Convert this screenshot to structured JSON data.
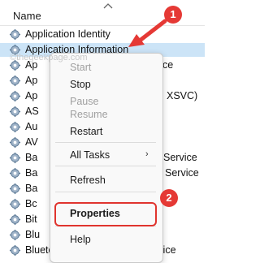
{
  "header": {
    "column_name": "Name"
  },
  "services": [
    {
      "name": "Application Identity",
      "tail": "",
      "selected": false
    },
    {
      "name": "Application Information",
      "tail": "",
      "selected": true
    },
    {
      "name": "Ap",
      "tail": "ce",
      "selected": false
    },
    {
      "name": "Ap",
      "tail": "",
      "selected": false
    },
    {
      "name": "Ap",
      "tail": "XSVC)",
      "selected": false
    },
    {
      "name": "AS",
      "tail": "",
      "selected": false
    },
    {
      "name": "Au",
      "tail": "",
      "selected": false
    },
    {
      "name": "AV",
      "tail": "",
      "selected": false
    },
    {
      "name": "Ba",
      "tail": "Service",
      "selected": false
    },
    {
      "name": "Ba",
      "tail": "Service",
      "selected": false
    },
    {
      "name": "Ba",
      "tail": "",
      "selected": false
    },
    {
      "name": "Bc",
      "tail": "",
      "selected": false
    },
    {
      "name": "Bit",
      "tail": "",
      "selected": false
    },
    {
      "name": "Blu",
      "tail": "",
      "selected": false
    },
    {
      "name": "Bluetooth Audio Gateway Service",
      "tail": "",
      "selected": false
    }
  ],
  "context_menu": {
    "start": "Start",
    "stop": "Stop",
    "pause": "Pause",
    "resume": "Resume",
    "restart": "Restart",
    "all_tasks": "All Tasks",
    "refresh": "Refresh",
    "properties": "Properties",
    "help": "Help"
  },
  "watermark": "©thegeekpage.com",
  "annotations": {
    "badge1": "1",
    "badge2": "2"
  },
  "colors": {
    "selection": "#cce4f7",
    "annotation_red": "#e53935"
  }
}
